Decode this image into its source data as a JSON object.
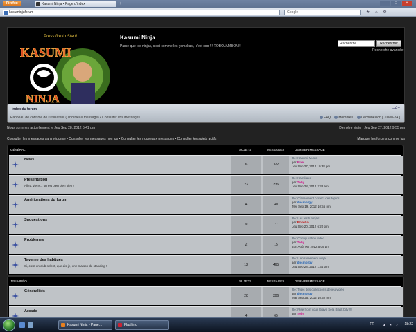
{
  "browser": {
    "menu_button": "Firefox",
    "tab_title": "Kasumi Ninja • Page d'index",
    "new_tab": "+",
    "address": "kasuminjaforum",
    "search_engine_placeholder": "Google",
    "window_controls": [
      "–",
      "□",
      "×"
    ]
  },
  "header": {
    "site_title": "Kasumi Ninja",
    "site_description": "Parce que les ninjas, c'est comme les yamakasi, c'est coo !!! ROBOJAMBON !!",
    "search_placeholder": "Recherche…",
    "search_button": "Rechercher",
    "advanced_search": "Recherche avancée",
    "logo_tagline": "Press fire to Start!",
    "logo_top": "KASUMI",
    "logo_bottom": "NINJA"
  },
  "navbar": {
    "index_link": "Index du forum",
    "left_links": "Panneau de contrôle de l'utilisateur (0 nouveau message) • Consulter vos messages",
    "right_links": [
      "FAQ",
      "Membres",
      "Déconnexion [ Julien-24 ]"
    ]
  },
  "info": {
    "current_time": "Nous sommes actuellement le Jeu Sep 28, 2012 5:41 pm",
    "last_visit": "Dernière visite : Jeu Sep 27, 2012 9:55 pm",
    "search_links": "Consulter les messages sans réponse • Consulter les messages non lus • Consulter les nouveaux messages • Consulter les sujets actifs",
    "mark_read": "Marquer les forums comme lus"
  },
  "columns": {
    "topics": "SUJETS",
    "posts": "MESSAGES",
    "last_post": "DERNIER MESSAGE"
  },
  "categories": [
    {
      "name": "GÉNÉRAL",
      "forums": [
        {
          "name": "News",
          "desc": "",
          "topics": "6",
          "posts": "122",
          "last_title": "Re: Kasumi Music",
          "last_by": "par ",
          "last_user": "Pixel",
          "user_color": "#c0208a",
          "last_date": "Jeu Sep 27, 2012 10:38 pm"
        },
        {
          "name": "Présentation",
          "desc": "Allez, viens... on est bien bien bien !",
          "topics": "22",
          "posts": "336",
          "last_title": "Re: Kamikaze",
          "last_by": "par ",
          "last_user": "Toby",
          "user_color": "#d01e8e",
          "last_date": "Jeu Sep 28, 2012 2:38 am"
        },
        {
          "name": "Améliorations du forum",
          "desc": "",
          "topics": "4",
          "posts": "40",
          "last_title": "Re: Classement correct des topics",
          "last_by": "par ",
          "last_user": "docmorgy",
          "user_color": "#1e5fb0",
          "last_date": "Mer Sep 19, 2012 10:55 pm"
        },
        {
          "name": "Suggestions",
          "desc": "",
          "topics": "9",
          "posts": "77",
          "last_title": "Re: Les tests ninja !",
          "last_by": "par ",
          "last_user": "Bbzeba",
          "user_color": "#c01818",
          "last_date": "Jeu Sep 20, 2012 6:20 pm"
        },
        {
          "name": "Problèmes",
          "desc": "",
          "topics": "2",
          "posts": "15",
          "last_title": "Re: Configuration vidéo",
          "last_by": "par ",
          "last_user": "Toby",
          "user_color": "#d01e8e",
          "last_date": "Lun Août 06, 2012 5:09 pm"
        },
        {
          "name": "Taverne des habitués",
          "desc": "Si, c'est un club select, que dis-je, une maison de standing !",
          "topics": "12",
          "posts": "465",
          "last_title": "Re: L'entraînement ninja !",
          "last_by": "par ",
          "last_user": "docmorgy",
          "user_color": "#1e5fb0",
          "last_date": "Jeu Sep 28, 2012 1:34 pm"
        }
      ]
    },
    {
      "name": "JEU VIDÉO",
      "forums": [
        {
          "name": "Généralités",
          "desc": "",
          "topics": "28",
          "posts": "306",
          "last_title": "Re: Topic des collections de jeu vidéo",
          "last_by": "par ",
          "last_user": "docmorgy",
          "user_color": "#1e5fb0",
          "last_date": "Mar Sep 25, 2012 10:52 pm"
        },
        {
          "name": "Arcade",
          "desc": "",
          "topics": "4",
          "posts": "65",
          "last_title": "Re: Rise from your Grave Sela Blast City !!!",
          "last_by": "par ",
          "last_user": "Toby",
          "user_color": "#d01e8e",
          "last_date": "Jeu Sep 28, 2012 2:46 am"
        }
      ]
    }
  ],
  "taskbar": {
    "tasks": [
      "Kasumi Ninja • Page…",
      "Flashing"
    ],
    "language": "FR",
    "clock": "18:22"
  },
  "colors": {
    "page_bg": "#222222",
    "row_bg": "#bfc3c7",
    "accent_blue": "#4a5a6a"
  }
}
